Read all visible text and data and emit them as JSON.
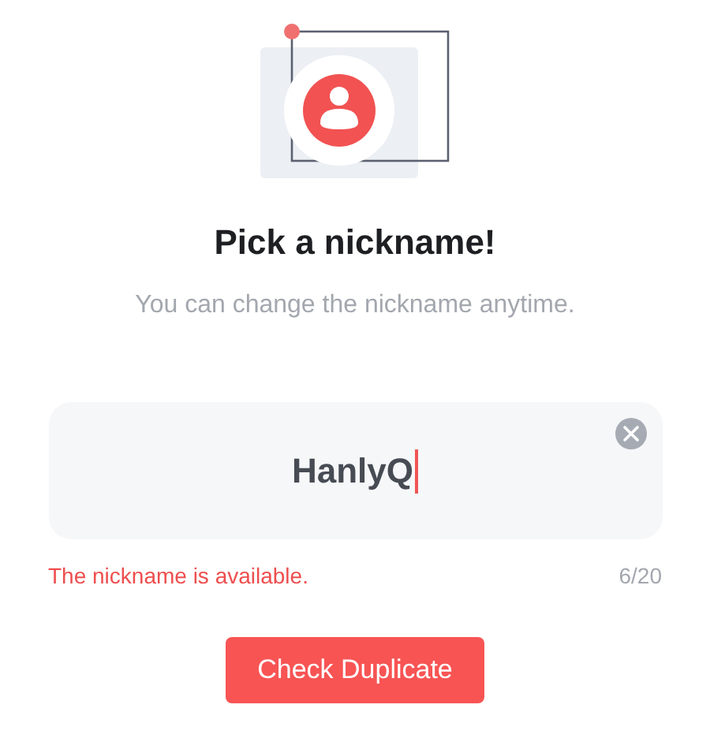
{
  "title": "Pick a nickname!",
  "subtitle": "You can change the nickname anytime.",
  "nickname_field": {
    "value": "HanlyQ",
    "focused": true
  },
  "message": "The nickname is available.",
  "counter": "6/20",
  "button": "Check Duplicate"
}
